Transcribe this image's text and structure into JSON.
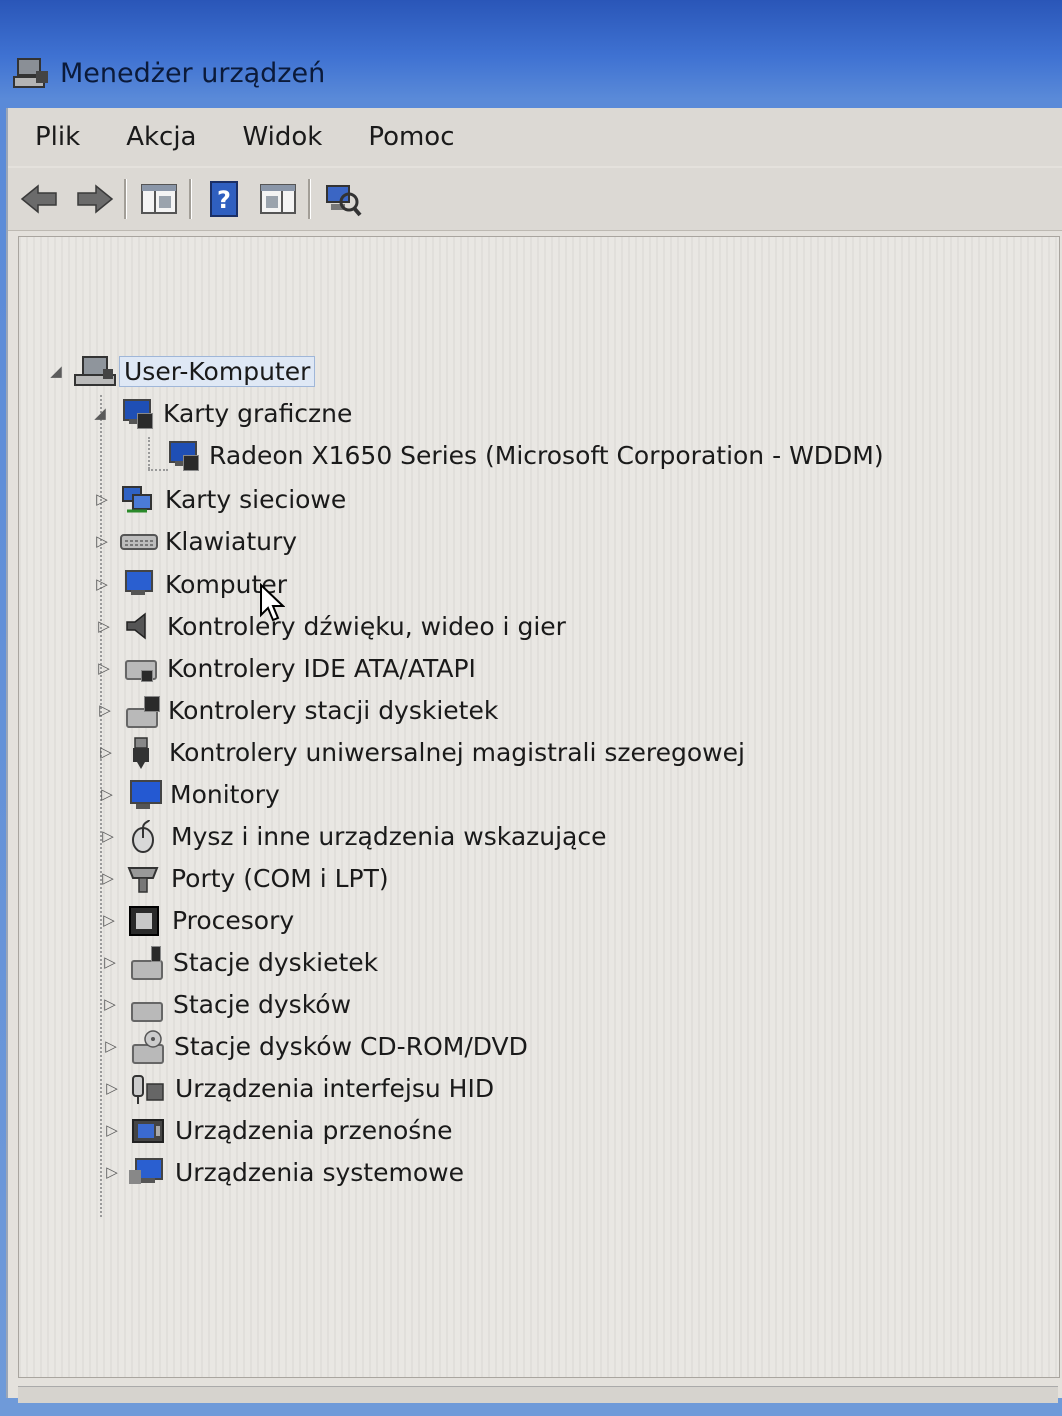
{
  "window": {
    "title": "Menedżer urządzeń"
  },
  "menu": [
    "Plik",
    "Akcja",
    "Widok",
    "Pomoc"
  ],
  "toolbar": {
    "buttons": [
      "back-icon",
      "forward-icon",
      "show-hide-console-tree-icon",
      "help-icon",
      "properties-icon",
      "scan-hardware-icon"
    ]
  },
  "tree": {
    "root": "User-Komputer",
    "categories": [
      {
        "label": "Karty graficzne",
        "expanded": true,
        "children": [
          "Radeon X1650 Series (Microsoft Corporation - WDDM)"
        ]
      },
      {
        "label": "Karty sieciowe"
      },
      {
        "label": "Klawiatury"
      },
      {
        "label": "Komputer"
      },
      {
        "label": "Kontrolery dźwięku, wideo i gier"
      },
      {
        "label": "Kontrolery IDE ATA/ATAPI"
      },
      {
        "label": "Kontrolery stacji dyskietek"
      },
      {
        "label": "Kontrolery uniwersalnej magistrali szeregowej"
      },
      {
        "label": "Monitory"
      },
      {
        "label": "Mysz i inne urządzenia wskazujące"
      },
      {
        "label": "Porty (COM i LPT)"
      },
      {
        "label": "Procesory"
      },
      {
        "label": "Stacje dyskietek"
      },
      {
        "label": "Stacje dysków"
      },
      {
        "label": "Stacje dysków CD-ROM/DVD"
      },
      {
        "label": "Urządzenia interfejsu HID"
      },
      {
        "label": "Urządzenia przenośne"
      },
      {
        "label": "Urządzenia systemowe"
      }
    ]
  }
}
